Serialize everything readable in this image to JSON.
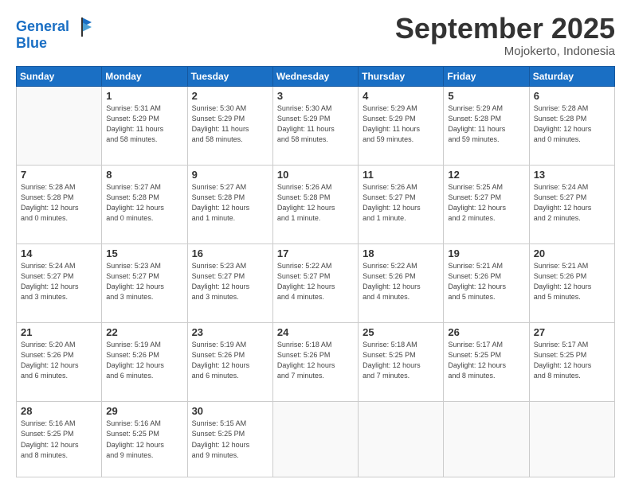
{
  "header": {
    "logo_line1": "General",
    "logo_line2": "Blue",
    "month": "September 2025",
    "location": "Mojokerto, Indonesia"
  },
  "weekdays": [
    "Sunday",
    "Monday",
    "Tuesday",
    "Wednesday",
    "Thursday",
    "Friday",
    "Saturday"
  ],
  "weeks": [
    [
      {
        "num": "",
        "info": ""
      },
      {
        "num": "1",
        "info": "Sunrise: 5:31 AM\nSunset: 5:29 PM\nDaylight: 11 hours\nand 58 minutes."
      },
      {
        "num": "2",
        "info": "Sunrise: 5:30 AM\nSunset: 5:29 PM\nDaylight: 11 hours\nand 58 minutes."
      },
      {
        "num": "3",
        "info": "Sunrise: 5:30 AM\nSunset: 5:29 PM\nDaylight: 11 hours\nand 58 minutes."
      },
      {
        "num": "4",
        "info": "Sunrise: 5:29 AM\nSunset: 5:29 PM\nDaylight: 11 hours\nand 59 minutes."
      },
      {
        "num": "5",
        "info": "Sunrise: 5:29 AM\nSunset: 5:28 PM\nDaylight: 11 hours\nand 59 minutes."
      },
      {
        "num": "6",
        "info": "Sunrise: 5:28 AM\nSunset: 5:28 PM\nDaylight: 12 hours\nand 0 minutes."
      }
    ],
    [
      {
        "num": "7",
        "info": "Sunrise: 5:28 AM\nSunset: 5:28 PM\nDaylight: 12 hours\nand 0 minutes."
      },
      {
        "num": "8",
        "info": "Sunrise: 5:27 AM\nSunset: 5:28 PM\nDaylight: 12 hours\nand 0 minutes."
      },
      {
        "num": "9",
        "info": "Sunrise: 5:27 AM\nSunset: 5:28 PM\nDaylight: 12 hours\nand 1 minute."
      },
      {
        "num": "10",
        "info": "Sunrise: 5:26 AM\nSunset: 5:28 PM\nDaylight: 12 hours\nand 1 minute."
      },
      {
        "num": "11",
        "info": "Sunrise: 5:26 AM\nSunset: 5:27 PM\nDaylight: 12 hours\nand 1 minute."
      },
      {
        "num": "12",
        "info": "Sunrise: 5:25 AM\nSunset: 5:27 PM\nDaylight: 12 hours\nand 2 minutes."
      },
      {
        "num": "13",
        "info": "Sunrise: 5:24 AM\nSunset: 5:27 PM\nDaylight: 12 hours\nand 2 minutes."
      }
    ],
    [
      {
        "num": "14",
        "info": "Sunrise: 5:24 AM\nSunset: 5:27 PM\nDaylight: 12 hours\nand 3 minutes."
      },
      {
        "num": "15",
        "info": "Sunrise: 5:23 AM\nSunset: 5:27 PM\nDaylight: 12 hours\nand 3 minutes."
      },
      {
        "num": "16",
        "info": "Sunrise: 5:23 AM\nSunset: 5:27 PM\nDaylight: 12 hours\nand 3 minutes."
      },
      {
        "num": "17",
        "info": "Sunrise: 5:22 AM\nSunset: 5:27 PM\nDaylight: 12 hours\nand 4 minutes."
      },
      {
        "num": "18",
        "info": "Sunrise: 5:22 AM\nSunset: 5:26 PM\nDaylight: 12 hours\nand 4 minutes."
      },
      {
        "num": "19",
        "info": "Sunrise: 5:21 AM\nSunset: 5:26 PM\nDaylight: 12 hours\nand 5 minutes."
      },
      {
        "num": "20",
        "info": "Sunrise: 5:21 AM\nSunset: 5:26 PM\nDaylight: 12 hours\nand 5 minutes."
      }
    ],
    [
      {
        "num": "21",
        "info": "Sunrise: 5:20 AM\nSunset: 5:26 PM\nDaylight: 12 hours\nand 6 minutes."
      },
      {
        "num": "22",
        "info": "Sunrise: 5:19 AM\nSunset: 5:26 PM\nDaylight: 12 hours\nand 6 minutes."
      },
      {
        "num": "23",
        "info": "Sunrise: 5:19 AM\nSunset: 5:26 PM\nDaylight: 12 hours\nand 6 minutes."
      },
      {
        "num": "24",
        "info": "Sunrise: 5:18 AM\nSunset: 5:26 PM\nDaylight: 12 hours\nand 7 minutes."
      },
      {
        "num": "25",
        "info": "Sunrise: 5:18 AM\nSunset: 5:25 PM\nDaylight: 12 hours\nand 7 minutes."
      },
      {
        "num": "26",
        "info": "Sunrise: 5:17 AM\nSunset: 5:25 PM\nDaylight: 12 hours\nand 8 minutes."
      },
      {
        "num": "27",
        "info": "Sunrise: 5:17 AM\nSunset: 5:25 PM\nDaylight: 12 hours\nand 8 minutes."
      }
    ],
    [
      {
        "num": "28",
        "info": "Sunrise: 5:16 AM\nSunset: 5:25 PM\nDaylight: 12 hours\nand 8 minutes."
      },
      {
        "num": "29",
        "info": "Sunrise: 5:16 AM\nSunset: 5:25 PM\nDaylight: 12 hours\nand 9 minutes."
      },
      {
        "num": "30",
        "info": "Sunrise: 5:15 AM\nSunset: 5:25 PM\nDaylight: 12 hours\nand 9 minutes."
      },
      {
        "num": "",
        "info": ""
      },
      {
        "num": "",
        "info": ""
      },
      {
        "num": "",
        "info": ""
      },
      {
        "num": "",
        "info": ""
      }
    ]
  ]
}
